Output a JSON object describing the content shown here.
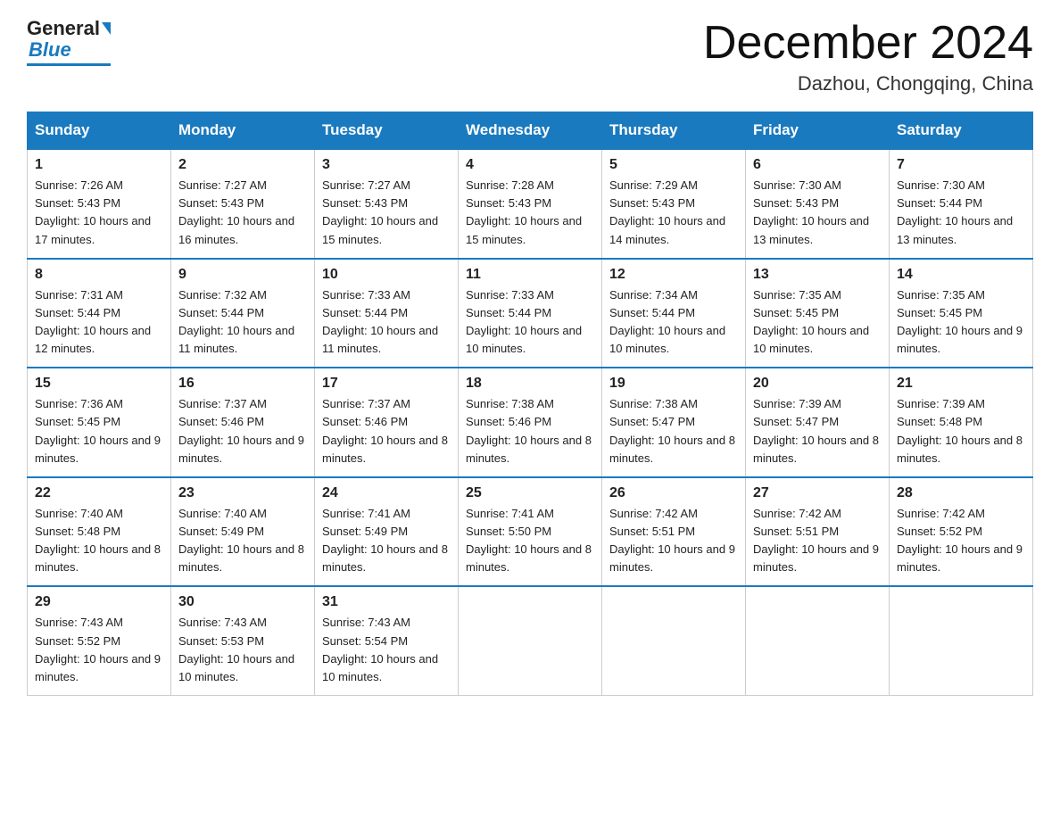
{
  "header": {
    "logo_text_main": "General",
    "logo_text_blue": "Blue",
    "title": "December 2024",
    "subtitle": "Dazhou, Chongqing, China"
  },
  "days_of_week": [
    "Sunday",
    "Monday",
    "Tuesday",
    "Wednesday",
    "Thursday",
    "Friday",
    "Saturday"
  ],
  "weeks": [
    [
      {
        "day": "1",
        "sunrise": "7:26 AM",
        "sunset": "5:43 PM",
        "daylight": "10 hours and 17 minutes."
      },
      {
        "day": "2",
        "sunrise": "7:27 AM",
        "sunset": "5:43 PM",
        "daylight": "10 hours and 16 minutes."
      },
      {
        "day": "3",
        "sunrise": "7:27 AM",
        "sunset": "5:43 PM",
        "daylight": "10 hours and 15 minutes."
      },
      {
        "day": "4",
        "sunrise": "7:28 AM",
        "sunset": "5:43 PM",
        "daylight": "10 hours and 15 minutes."
      },
      {
        "day": "5",
        "sunrise": "7:29 AM",
        "sunset": "5:43 PM",
        "daylight": "10 hours and 14 minutes."
      },
      {
        "day": "6",
        "sunrise": "7:30 AM",
        "sunset": "5:43 PM",
        "daylight": "10 hours and 13 minutes."
      },
      {
        "day": "7",
        "sunrise": "7:30 AM",
        "sunset": "5:44 PM",
        "daylight": "10 hours and 13 minutes."
      }
    ],
    [
      {
        "day": "8",
        "sunrise": "7:31 AM",
        "sunset": "5:44 PM",
        "daylight": "10 hours and 12 minutes."
      },
      {
        "day": "9",
        "sunrise": "7:32 AM",
        "sunset": "5:44 PM",
        "daylight": "10 hours and 11 minutes."
      },
      {
        "day": "10",
        "sunrise": "7:33 AM",
        "sunset": "5:44 PM",
        "daylight": "10 hours and 11 minutes."
      },
      {
        "day": "11",
        "sunrise": "7:33 AM",
        "sunset": "5:44 PM",
        "daylight": "10 hours and 10 minutes."
      },
      {
        "day": "12",
        "sunrise": "7:34 AM",
        "sunset": "5:44 PM",
        "daylight": "10 hours and 10 minutes."
      },
      {
        "day": "13",
        "sunrise": "7:35 AM",
        "sunset": "5:45 PM",
        "daylight": "10 hours and 10 minutes."
      },
      {
        "day": "14",
        "sunrise": "7:35 AM",
        "sunset": "5:45 PM",
        "daylight": "10 hours and 9 minutes."
      }
    ],
    [
      {
        "day": "15",
        "sunrise": "7:36 AM",
        "sunset": "5:45 PM",
        "daylight": "10 hours and 9 minutes."
      },
      {
        "day": "16",
        "sunrise": "7:37 AM",
        "sunset": "5:46 PM",
        "daylight": "10 hours and 9 minutes."
      },
      {
        "day": "17",
        "sunrise": "7:37 AM",
        "sunset": "5:46 PM",
        "daylight": "10 hours and 8 minutes."
      },
      {
        "day": "18",
        "sunrise": "7:38 AM",
        "sunset": "5:46 PM",
        "daylight": "10 hours and 8 minutes."
      },
      {
        "day": "19",
        "sunrise": "7:38 AM",
        "sunset": "5:47 PM",
        "daylight": "10 hours and 8 minutes."
      },
      {
        "day": "20",
        "sunrise": "7:39 AM",
        "sunset": "5:47 PM",
        "daylight": "10 hours and 8 minutes."
      },
      {
        "day": "21",
        "sunrise": "7:39 AM",
        "sunset": "5:48 PM",
        "daylight": "10 hours and 8 minutes."
      }
    ],
    [
      {
        "day": "22",
        "sunrise": "7:40 AM",
        "sunset": "5:48 PM",
        "daylight": "10 hours and 8 minutes."
      },
      {
        "day": "23",
        "sunrise": "7:40 AM",
        "sunset": "5:49 PM",
        "daylight": "10 hours and 8 minutes."
      },
      {
        "day": "24",
        "sunrise": "7:41 AM",
        "sunset": "5:49 PM",
        "daylight": "10 hours and 8 minutes."
      },
      {
        "day": "25",
        "sunrise": "7:41 AM",
        "sunset": "5:50 PM",
        "daylight": "10 hours and 8 minutes."
      },
      {
        "day": "26",
        "sunrise": "7:42 AM",
        "sunset": "5:51 PM",
        "daylight": "10 hours and 9 minutes."
      },
      {
        "day": "27",
        "sunrise": "7:42 AM",
        "sunset": "5:51 PM",
        "daylight": "10 hours and 9 minutes."
      },
      {
        "day": "28",
        "sunrise": "7:42 AM",
        "sunset": "5:52 PM",
        "daylight": "10 hours and 9 minutes."
      }
    ],
    [
      {
        "day": "29",
        "sunrise": "7:43 AM",
        "sunset": "5:52 PM",
        "daylight": "10 hours and 9 minutes."
      },
      {
        "day": "30",
        "sunrise": "7:43 AM",
        "sunset": "5:53 PM",
        "daylight": "10 hours and 10 minutes."
      },
      {
        "day": "31",
        "sunrise": "7:43 AM",
        "sunset": "5:54 PM",
        "daylight": "10 hours and 10 minutes."
      },
      null,
      null,
      null,
      null
    ]
  ]
}
